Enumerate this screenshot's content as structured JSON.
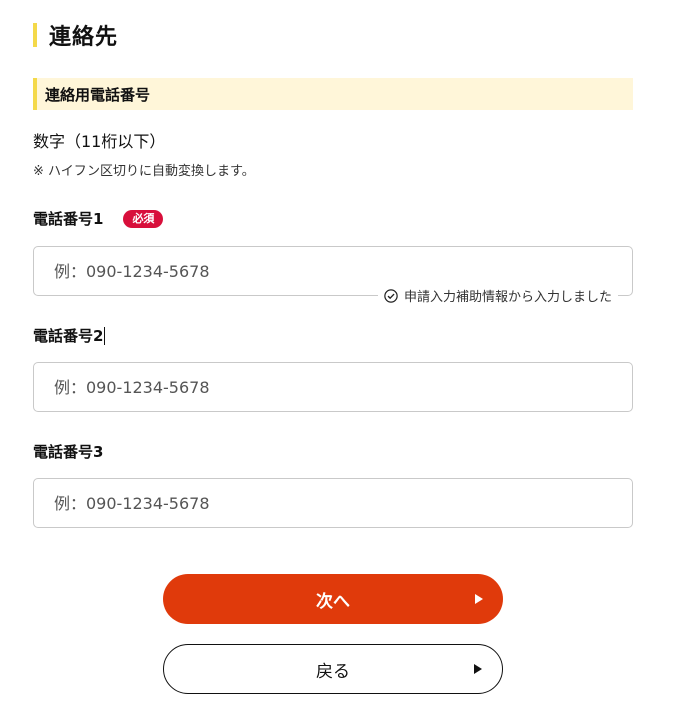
{
  "page": {
    "title": "連絡先"
  },
  "section": {
    "heading": "連絡用電話番号"
  },
  "hints": {
    "main": "数字（11桁以下）",
    "sub": "※ ハイフン区切りに自動変換します。"
  },
  "phone1": {
    "label": "電話番号1",
    "required_badge": "必須",
    "placeholder": "例：090-1234-5678",
    "autofill_note": "申請入力補助情報から入力しました"
  },
  "phone2": {
    "label": "電話番号2",
    "placeholder": "例：090-1234-5678"
  },
  "phone3": {
    "label": "電話番号3",
    "placeholder": "例：090-1234-5678"
  },
  "buttons": {
    "next": "次へ",
    "back": "戻る"
  },
  "colors": {
    "accent_yellow": "#f4d94a",
    "section_bg": "#fff6d9",
    "required_red": "#d80f3b",
    "primary_orange": "#e03a0b"
  }
}
